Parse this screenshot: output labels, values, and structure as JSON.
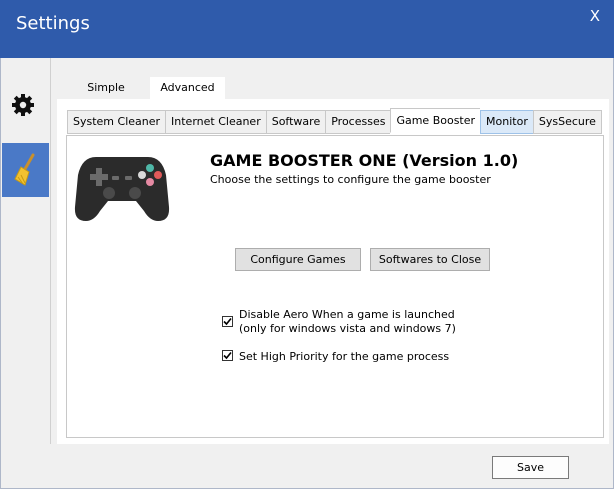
{
  "window": {
    "title": "Settings",
    "close_label": "X"
  },
  "sidebar": {
    "items": [
      {
        "icon": "gear-icon"
      },
      {
        "icon": "broom-icon",
        "active": true
      }
    ]
  },
  "mode_tabs": [
    {
      "label": "Simple"
    },
    {
      "label": "Advanced",
      "active": true
    }
  ],
  "sub_tabs": [
    {
      "label": "System Cleaner"
    },
    {
      "label": "Internet Cleaner"
    },
    {
      "label": "Software"
    },
    {
      "label": "Processes"
    },
    {
      "label": "Game Booster",
      "active": true
    },
    {
      "label": "Monitor"
    },
    {
      "label": "SysSecure"
    }
  ],
  "game_booster": {
    "heading": "GAME BOOSTER ONE (Version 1.0)",
    "subheading": "Choose the settings to configure the game booster",
    "configure_label": "Configure Games",
    "softwares_label": "Softwares to Close",
    "options": [
      {
        "line1": "Disable Aero When a game is launched",
        "line2": "(only for windows vista and windows 7)",
        "checked": true
      },
      {
        "line1": "Set High Priority for the game process",
        "checked": true
      }
    ]
  },
  "footer": {
    "save_label": "Save"
  },
  "colors": {
    "titlebar": "#2f5bab",
    "sidebar_active": "#4a79c7"
  }
}
